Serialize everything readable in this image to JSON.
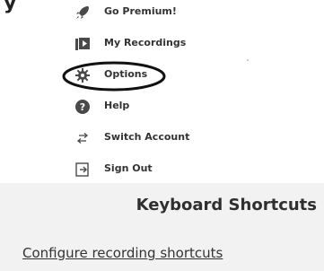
{
  "header": {
    "cropped_text": "y"
  },
  "menu": {
    "items": [
      {
        "label": "Go Premium!",
        "icon": "rocket-icon"
      },
      {
        "label": "My Recordings",
        "icon": "recordings-icon"
      },
      {
        "label": "Options",
        "icon": "gear-icon"
      },
      {
        "label": "Help",
        "icon": "help-icon"
      },
      {
        "label": "Switch Account",
        "icon": "switch-account-icon"
      },
      {
        "label": "Sign Out",
        "icon": "sign-out-icon"
      }
    ]
  },
  "shortcuts": {
    "title": "Keyboard Shortcuts",
    "configure_link": "Configure recording shortcuts"
  },
  "colors": {
    "panel_background": "#f2f2f2",
    "text": "#333333",
    "icon": "#4a4a4a"
  }
}
